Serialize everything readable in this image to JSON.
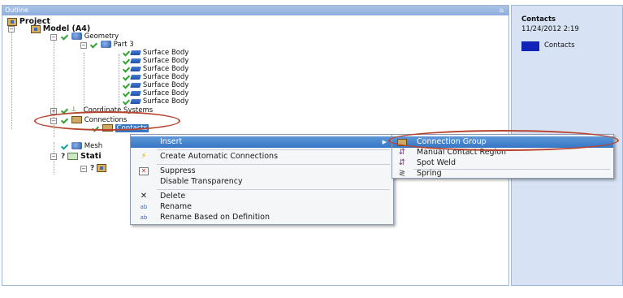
{
  "outline": {
    "title": "Outline",
    "pin": "⌂",
    "tree": {
      "project": "Project",
      "model": "Model (A4)",
      "geometry": "Geometry",
      "part": "Part 3",
      "surface_bodies": [
        "Surface Body",
        "Surface Body",
        "Surface Body",
        "Surface Body",
        "Surface Body",
        "Surface Body",
        "Surface Body"
      ],
      "coordinate_systems": "Coordinate Systems",
      "connections": "Connections",
      "contacts": "Contacts",
      "mesh": "Mesh",
      "static": "Stati"
    }
  },
  "right_panel": {
    "title": "Contacts",
    "date": "11/24/2012 2:19",
    "legend_label": "Contacts",
    "legend_color": "#1224b8"
  },
  "context_menu": {
    "items": [
      {
        "label": "Insert",
        "icon": "",
        "highlighted": true,
        "has_submenu": true
      },
      {
        "label": "Create Automatic Connections",
        "icon": "lightning-icon"
      },
      {
        "label": "Suppress",
        "icon": "suppress-icon"
      },
      {
        "label": "Disable Transparency",
        "icon": ""
      },
      {
        "label": "Delete",
        "icon": "x-icon"
      },
      {
        "label": "Rename",
        "icon": "rename-icon"
      },
      {
        "label": "Rename Based on Definition",
        "icon": "rename-icon"
      }
    ]
  },
  "sub_menu": {
    "items": [
      {
        "label": "Connection Group",
        "icon": "connection-group-icon",
        "highlighted": true
      },
      {
        "label": "Manual Contact Region",
        "icon": "contact-region-icon"
      },
      {
        "label": "Spot Weld",
        "icon": "spot-weld-icon"
      },
      {
        "label": "Spring",
        "icon": "spring-icon"
      }
    ]
  },
  "colors": {
    "highlight": "#3676c4",
    "annotation": "#b6442f",
    "panel_header": "#9bb9e2"
  }
}
